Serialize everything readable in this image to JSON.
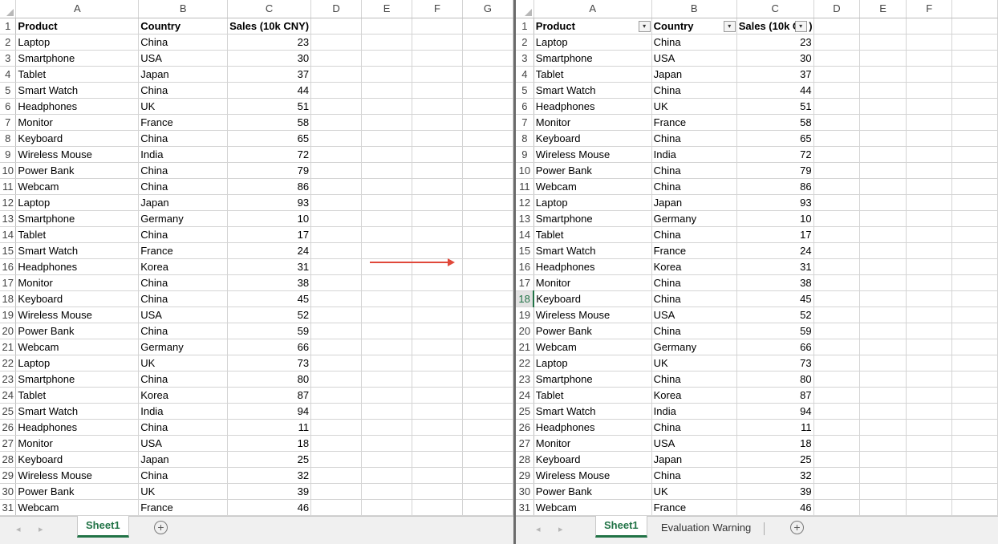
{
  "columns_left": [
    "A",
    "B",
    "C",
    "D",
    "E",
    "F",
    "G"
  ],
  "columns_right": [
    "A",
    "B",
    "C",
    "D",
    "E",
    "F"
  ],
  "header_row": {
    "product": "Product",
    "country": "Country",
    "sales_left": "Sales (10k CNY)",
    "sales_right": "Sales (10k C",
    "sales_right_tail": ")"
  },
  "filter_glyph": "▾",
  "rows": [
    {
      "n": "1"
    },
    {
      "n": "2",
      "product": "Laptop",
      "country": "China",
      "sales": "23"
    },
    {
      "n": "3",
      "product": "Smartphone",
      "country": "USA",
      "sales": "30"
    },
    {
      "n": "4",
      "product": "Tablet",
      "country": "Japan",
      "sales": "37"
    },
    {
      "n": "5",
      "product": "Smart Watch",
      "country": "China",
      "sales": "44"
    },
    {
      "n": "6",
      "product": "Headphones",
      "country": "UK",
      "sales": "51"
    },
    {
      "n": "7",
      "product": "Monitor",
      "country": "France",
      "sales": "58"
    },
    {
      "n": "8",
      "product": "Keyboard",
      "country": "China",
      "sales": "65"
    },
    {
      "n": "9",
      "product": "Wireless Mouse",
      "country": "India",
      "sales": "72"
    },
    {
      "n": "10",
      "product": "Power Bank",
      "country": "China",
      "sales": "79"
    },
    {
      "n": "11",
      "product": "Webcam",
      "country": "China",
      "sales": "86"
    },
    {
      "n": "12",
      "product": "Laptop",
      "country": "Japan",
      "sales": "93"
    },
    {
      "n": "13",
      "product": "Smartphone",
      "country": "Germany",
      "sales": "10"
    },
    {
      "n": "14",
      "product": "Tablet",
      "country": "China",
      "sales": "17"
    },
    {
      "n": "15",
      "product": "Smart Watch",
      "country": "France",
      "sales": "24"
    },
    {
      "n": "16",
      "product": "Headphones",
      "country": "Korea",
      "sales": "31"
    },
    {
      "n": "17",
      "product": "Monitor",
      "country": "China",
      "sales": "38"
    },
    {
      "n": "18",
      "product": "Keyboard",
      "country": "China",
      "sales": "45"
    },
    {
      "n": "19",
      "product": "Wireless Mouse",
      "country": "USA",
      "sales": "52"
    },
    {
      "n": "20",
      "product": "Power Bank",
      "country": "China",
      "sales": "59"
    },
    {
      "n": "21",
      "product": "Webcam",
      "country": "Germany",
      "sales": "66"
    },
    {
      "n": "22",
      "product": "Laptop",
      "country": "UK",
      "sales": "73"
    },
    {
      "n": "23",
      "product": "Smartphone",
      "country": "China",
      "sales": "80"
    },
    {
      "n": "24",
      "product": "Tablet",
      "country": "Korea",
      "sales": "87"
    },
    {
      "n": "25",
      "product": "Smart Watch",
      "country": "India",
      "sales": "94"
    },
    {
      "n": "26",
      "product": "Headphones",
      "country": "China",
      "sales": "11"
    },
    {
      "n": "27",
      "product": "Monitor",
      "country": "USA",
      "sales": "18"
    },
    {
      "n": "28",
      "product": "Keyboard",
      "country": "Japan",
      "sales": "25"
    },
    {
      "n": "29",
      "product": "Wireless Mouse",
      "country": "China",
      "sales": "32"
    },
    {
      "n": "30",
      "product": "Power Bank",
      "country": "UK",
      "sales": "39"
    },
    {
      "n": "31",
      "product": "Webcam",
      "country": "France",
      "sales": "46"
    }
  ],
  "left_tabs": {
    "prev_arrow": "◂",
    "next_arrow": "▸",
    "sheet1": "Sheet1",
    "add_glyph": "+"
  },
  "right_tabs": {
    "prev_arrow": "◂",
    "next_arrow": "▸",
    "sheet1": "Sheet1",
    "warning": "Evaluation Warning",
    "add_glyph": "+"
  },
  "active_row_right": "18",
  "colors": {
    "excel_green": "#217346",
    "arrow_red": "#e0483a",
    "grid_line": "#d4d4d4"
  }
}
